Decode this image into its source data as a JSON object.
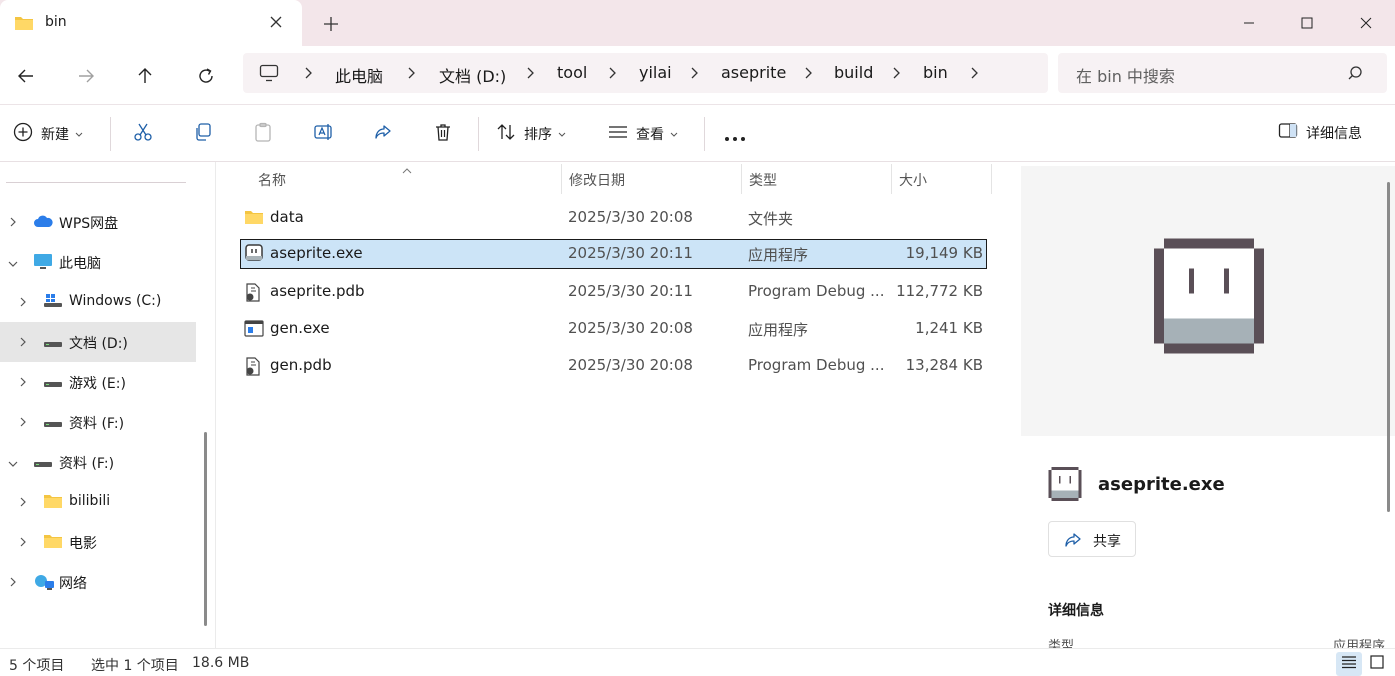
{
  "window": {
    "tab_title": "bin"
  },
  "address": {
    "segments": [
      "此电脑",
      "文档 (D:)",
      "tool",
      "yilai",
      "aseprite",
      "build",
      "bin"
    ]
  },
  "search": {
    "placeholder": "在 bin 中搜索"
  },
  "toolbar": {
    "new_label": "新建",
    "sort_label": "排序",
    "view_label": "查看",
    "details_label": "详细信息"
  },
  "sidebar": {
    "items": [
      {
        "label": "WPS网盘"
      },
      {
        "label": "此电脑"
      },
      {
        "label": "Windows (C:)"
      },
      {
        "label": "文档 (D:)"
      },
      {
        "label": "游戏 (E:)"
      },
      {
        "label": "资料 (F:)"
      },
      {
        "label": "资料 (F:)"
      },
      {
        "label": "bilibili"
      },
      {
        "label": "电影"
      },
      {
        "label": "网络"
      }
    ]
  },
  "columns": {
    "name": "名称",
    "date": "修改日期",
    "type": "类型",
    "size": "大小"
  },
  "files": [
    {
      "name": "data",
      "date": "2025/3/30 20:08",
      "type": "文件夹",
      "size": ""
    },
    {
      "name": "aseprite.exe",
      "date": "2025/3/30 20:11",
      "type": "应用程序",
      "size": "19,149 KB"
    },
    {
      "name": "aseprite.pdb",
      "date": "2025/3/30 20:11",
      "type": "Program Debug ...",
      "size": "112,772 KB"
    },
    {
      "name": "gen.exe",
      "date": "2025/3/30 20:08",
      "type": "应用程序",
      "size": "1,241 KB"
    },
    {
      "name": "gen.pdb",
      "date": "2025/3/30 20:08",
      "type": "Program Debug ...",
      "size": "13,284 KB"
    }
  ],
  "details": {
    "file_name": "aseprite.exe",
    "share_label": "共享",
    "heading": "详细信息",
    "type_key": "类型",
    "type_value": "应用程序"
  },
  "status": {
    "count": "5 个项目",
    "selection": "选中 1 个项目",
    "size": "18.6 MB"
  },
  "colors": {
    "accent": "#0067c0",
    "selection": "#cce4f7",
    "folder": "#f4c542"
  }
}
